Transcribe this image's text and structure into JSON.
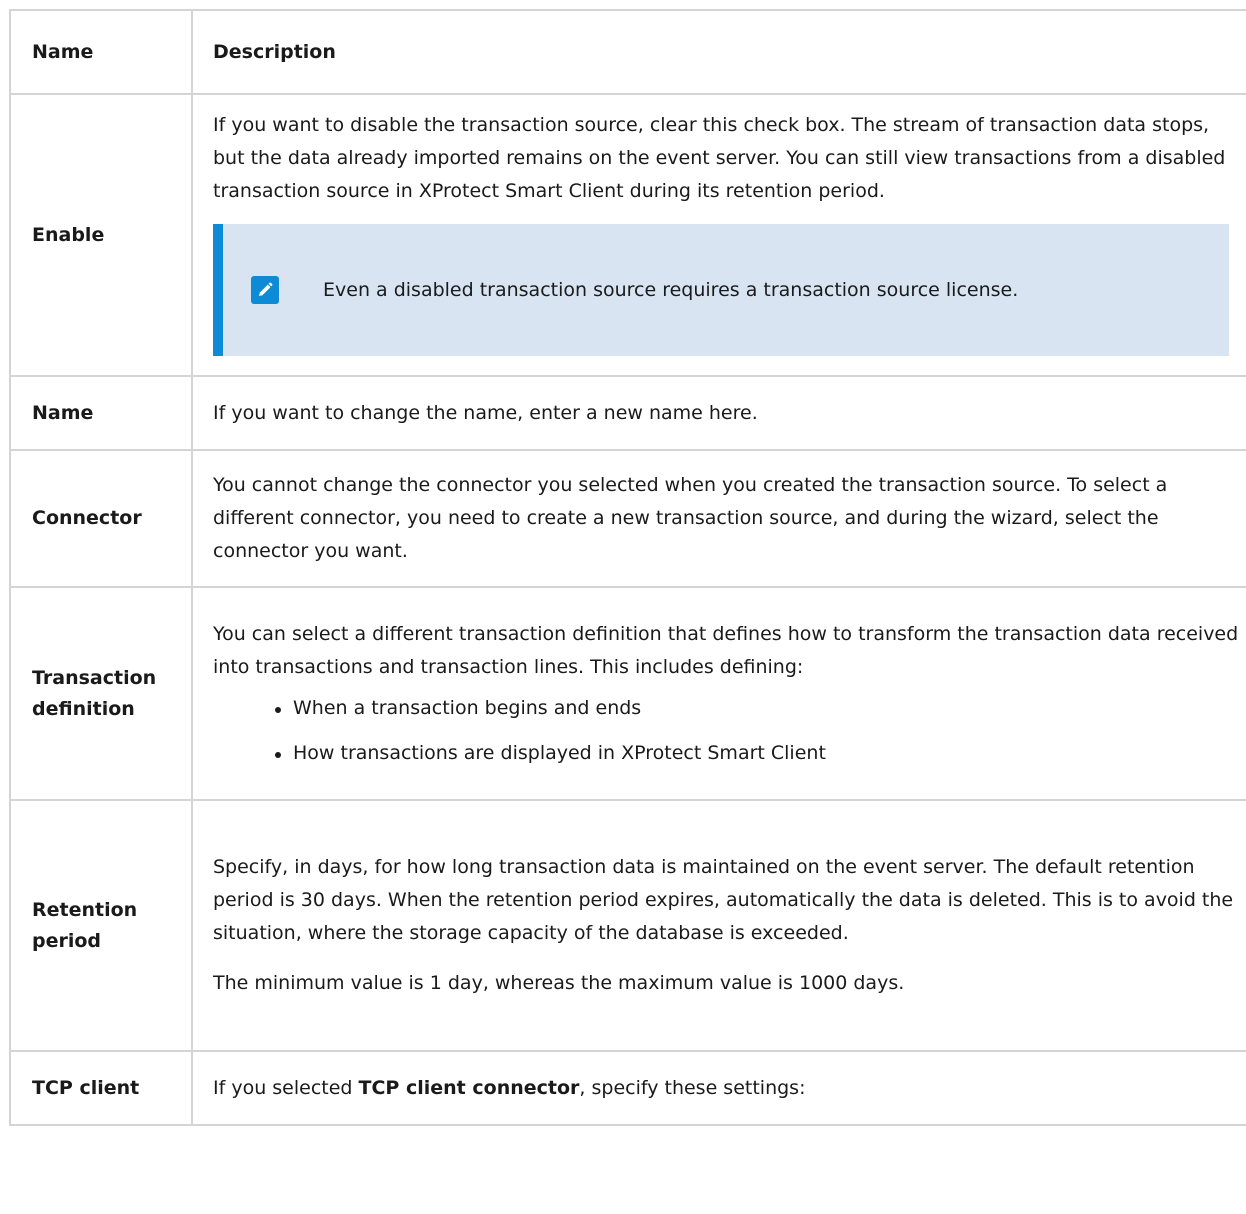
{
  "header": {
    "name": "Name",
    "description": "Description"
  },
  "rows": {
    "enable": {
      "name": "Enable",
      "desc": "If you want to disable the transaction source, clear this check box. The stream of transaction data stops, but the data already imported remains on the event server. You can still view transactions from a disabled transaction source in XProtect Smart Client during its retention period.",
      "note": "Even a disabled transaction source requires a transaction source license.",
      "note_icon": "pencil-icon"
    },
    "name": {
      "name": "Name",
      "desc": "If you want to change the name, enter a new name here."
    },
    "connector": {
      "name": "Connector",
      "desc": "You cannot change the connector you selected when you created the transaction source. To select a different connector, you need to create a new transaction source, and during the wizard, select the connector you want."
    },
    "definition": {
      "name": "Transaction definition",
      "desc": "You can select a different transaction definition that defines how to transform the transaction data received into transactions and transaction lines. This includes defining:",
      "bullets": [
        "When a transaction begins and ends",
        "How transactions are displayed in XProtect Smart Client"
      ]
    },
    "retention": {
      "name": "Retention period",
      "desc": "Specify, in days, for how long transaction data is maintained on the event server. The default retention period is 30 days. When the retention period expires, automatically the data is deleted. This is to avoid the situation, where the storage capacity of the database is exceeded.",
      "desc2": "The minimum value is 1 day, whereas the maximum value is 1000 days."
    },
    "tcp": {
      "name": "TCP client",
      "desc_prefix": "If you selected ",
      "desc_bold": "TCP client connector",
      "desc_suffix": ", specify these settings:"
    }
  }
}
